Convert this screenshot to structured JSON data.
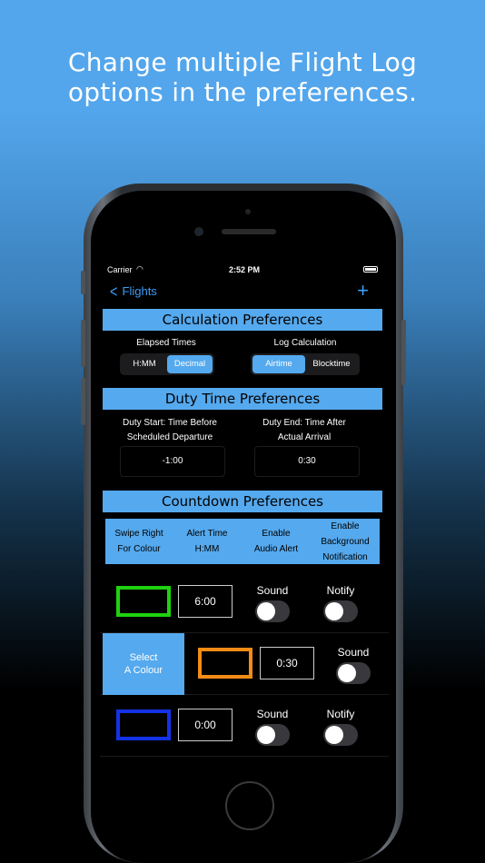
{
  "headline": {
    "line1": "Change multiple Flight Log",
    "line2": "options in the preferences."
  },
  "status": {
    "carrier": "Carrier",
    "time": "2:52 PM"
  },
  "nav": {
    "back_label": "Flights",
    "add_icon": "plus-icon"
  },
  "calculation": {
    "title": "Calculation Preferences",
    "elapsed_label": "Elapsed Times",
    "elapsed_options": [
      "H:MM",
      "Decimal"
    ],
    "elapsed_selected": "Decimal",
    "log_label": "Log Calculation",
    "log_options": [
      "Airtime",
      "Blocktime"
    ],
    "log_selected": "Airtime"
  },
  "duty": {
    "title": "Duty Time Preferences",
    "start_label_1": "Duty Start: Time Before",
    "start_label_2": "Scheduled Departure",
    "start_value": "-1:00",
    "end_label_1": "Duty End: Time After",
    "end_label_2": "Actual Arrival",
    "end_value": "0:30"
  },
  "countdown": {
    "title": "Countdown Preferences",
    "columns": [
      [
        "Swipe Right",
        "For Colour"
      ],
      [
        "Alert Time",
        "H:MM"
      ],
      [
        "Enable",
        "Audio Alert"
      ],
      [
        "Enable",
        "Background",
        "Notification"
      ]
    ],
    "rows": [
      {
        "color": "#1ed20f",
        "time": "6:00",
        "sound_label": "Sound",
        "notify_label": "Notify",
        "sound_on": false,
        "notify_on": false
      },
      {
        "color": "#f28c16",
        "time": "0:30",
        "sound_label": "Sound",
        "sound_on": false,
        "action_label_1": "Select",
        "action_label_2": "A Colour"
      },
      {
        "color": "#1432e6",
        "time": "0:00",
        "sound_label": "Sound",
        "notify_label": "Notify",
        "sound_on": false,
        "notify_on": false
      }
    ]
  },
  "colors": {
    "accent": "#55a9ee",
    "link": "#3e9cf5"
  }
}
